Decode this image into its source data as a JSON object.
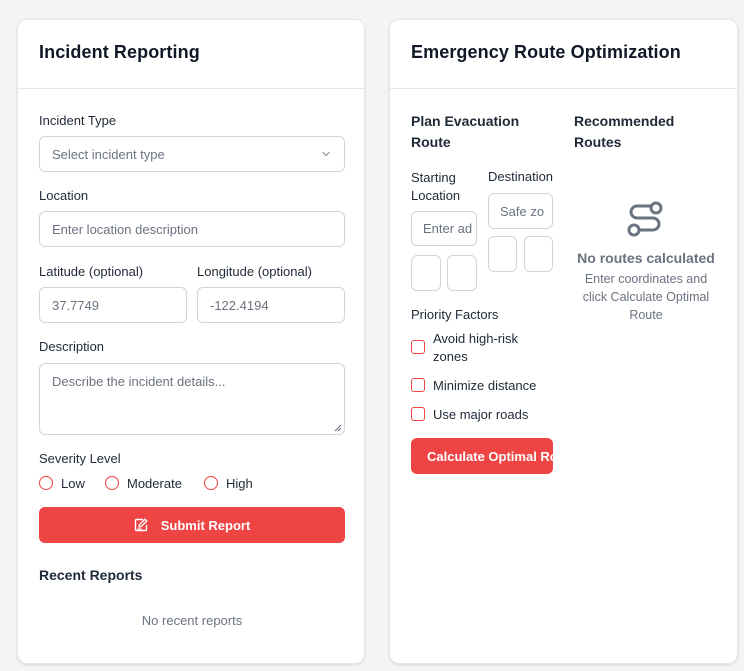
{
  "incident_panel": {
    "title": "Incident Reporting",
    "incident_type_label": "Incident Type",
    "incident_type_placeholder": "Select incident type",
    "location_label": "Location",
    "location_placeholder": "Enter location description",
    "latitude_label": "Latitude (optional)",
    "latitude_placeholder": "37.7749",
    "longitude_label": "Longitude (optional)",
    "longitude_placeholder": "-122.4194",
    "description_label": "Description",
    "description_placeholder": "Describe the incident details...",
    "severity_label": "Severity Level",
    "severity_options": [
      "Low",
      "Moderate",
      "High"
    ],
    "submit_label": "Submit Report",
    "recent_title": "Recent Reports",
    "recent_empty": "No recent reports"
  },
  "route_panel": {
    "title": "Emergency Route Optimization",
    "plan_title": "Plan Evacuation Route",
    "starting_label": "Starting Location",
    "starting_placeholder": "Enter ad",
    "destination_label": "Destination",
    "destination_placeholder": "Safe zo",
    "priority_title": "Priority Factors",
    "priority_options": [
      "Avoid high-risk zones",
      "Minimize distance",
      "Use major roads"
    ],
    "calculate_label": "Calculate Optimal Route",
    "recommended_title": "Recommended Routes",
    "empty_title": "No routes calculated",
    "empty_desc": "Enter coordinates and click Calculate Optimal Route"
  },
  "colors": {
    "accent": "#ef4444",
    "border": "#d1d5db",
    "muted_text": "#6b7280",
    "route_icon": "#6b7280"
  },
  "icons": {
    "submit": "edit-note-icon",
    "empty_routes": "route-icon",
    "select": "chevron-down-icon"
  }
}
